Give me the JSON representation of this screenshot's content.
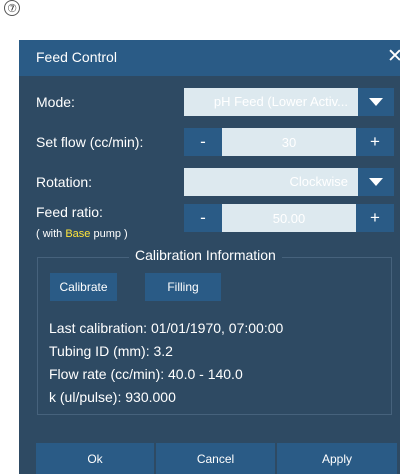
{
  "step_marker": "⑦",
  "dialog": {
    "title": "Feed Control",
    "close_symbol": "✕"
  },
  "mode": {
    "label": "Mode:",
    "value": "pH Feed (Lower Activ..."
  },
  "set_flow": {
    "label": "Set flow (cc/min):",
    "minus": "-",
    "value": "30",
    "plus": "+"
  },
  "rotation": {
    "label": "Rotation:",
    "value": "Clockwise"
  },
  "feed_ratio": {
    "label": "Feed ratio:",
    "note_prefix": "( with ",
    "note_highlight": "Base",
    "note_suffix": " pump )",
    "minus": "-",
    "value": "50.00",
    "plus": "+"
  },
  "calibration": {
    "title": "Calibration Information",
    "calibrate_label": "Calibrate",
    "filling_label": "Filling",
    "last_calibration": "Last calibration: 01/01/1970, 07:00:00",
    "tubing_id": "Tubing ID (mm): 3.2",
    "flow_rate": "Flow rate (cc/min): 40.0 - 140.0",
    "k_value": "k (ul/pulse): 930.000"
  },
  "footer": {
    "ok_label": "Ok",
    "cancel_label": "Cancel",
    "apply_label": "Apply"
  },
  "colors": {
    "dialog_bg": "#2e4a63",
    "button_bg": "#2a5b86",
    "field_bg": "#dde9ef",
    "highlight": "#ffe53b"
  }
}
